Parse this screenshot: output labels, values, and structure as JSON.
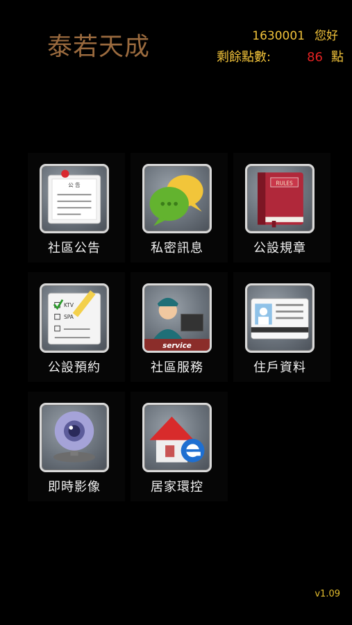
{
  "header": {
    "app_title": "泰若天成",
    "user_id": "1630001",
    "greeting": "您好",
    "points_label": "剩餘點數:",
    "points_value": "86",
    "points_unit": "點"
  },
  "menu": [
    {
      "label": "社區公告",
      "icon": "bulletin-board-icon"
    },
    {
      "label": "私密訊息",
      "icon": "chat-bubbles-icon"
    },
    {
      "label": "公設規章",
      "icon": "rules-book-icon"
    },
    {
      "label": "公設預約",
      "icon": "reservation-checklist-icon"
    },
    {
      "label": "社區服務",
      "icon": "service-agent-icon"
    },
    {
      "label": "住戶資料",
      "icon": "id-card-icon"
    },
    {
      "label": "即時影像",
      "icon": "webcam-icon"
    },
    {
      "label": "居家環控",
      "icon": "smart-home-icon"
    }
  ],
  "icon_text": {
    "bulletin_heading": "公 告",
    "rules_book_text": "RULES",
    "checklist_item_1": "KTV",
    "checklist_item_2": "SPA",
    "service_text": "service"
  },
  "footer": {
    "version": "v1.09"
  },
  "colors": {
    "background": "#000000",
    "title": "#9a6a3e",
    "accent_yellow": "#f2c33a",
    "points_red": "#e42222"
  }
}
